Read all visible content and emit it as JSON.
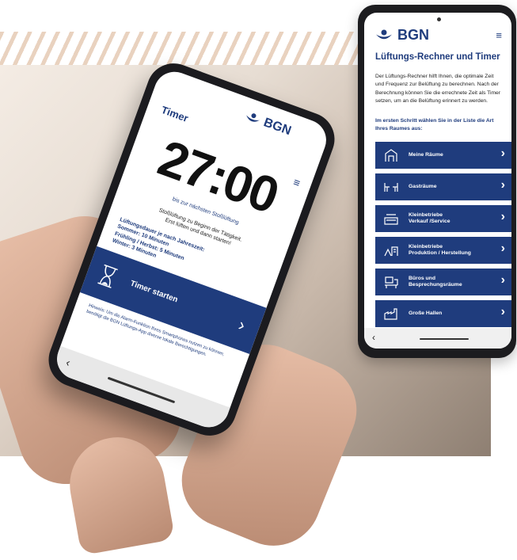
{
  "brand": {
    "logo_text": "BGN",
    "primary_color": "#1f3c7d",
    "accent_stripe_color": "#e9d2bf"
  },
  "phone_left": {
    "screen_title": "Timer",
    "timer_value": "27:00",
    "sub_label": "bis zur nächsten Stoßlüftung",
    "info_lines": [
      "Stoßlüftung zu Beginn der Tätigkeit.",
      "Erst lüften und dann starten!"
    ],
    "season_heading": "Lüftungsdauer je nach Jahreszeit:",
    "seasons": [
      "Sommer: 10 Minuten",
      "Frühling / Herbst: 5 Minuten",
      "Winter: 3 Minuten"
    ],
    "start_button": "Timer starten",
    "hint_text": "Hinweis: Um die Alarm-Funktion Ihres Smartphones nutzen zu können, benötigt die BGN Lüftungs-App diverse lokale Berechtigungen.",
    "menu_icon": "hamburger-icon",
    "back_icon": "chevron-left-icon"
  },
  "phone_right": {
    "app_title": "Lüftungs-Rechner und Timer",
    "description": "Der Lüftungs-Rechner hilft Ihnen, die optimale Zeit und Frequenz zur Belüftung zu berechnen. Nach der Berechnung können Sie die errechnete Zeit als Timer setzen, um an die Belüftung erinnert zu werden.",
    "step_text": "Im ersten Schritt wählen Sie in der Liste die Art Ihres Raumes aus:",
    "menu_icon": "hamburger-icon",
    "back_icon": "chevron-left-icon",
    "rooms": [
      {
        "label": "Meine Räume",
        "icon": "saved-rooms-icon"
      },
      {
        "label": "Gasträume",
        "icon": "dining-tables-icon"
      },
      {
        "label": "Kleinbetriebe\nVerkauf /Service",
        "icon": "counter-icon"
      },
      {
        "label": "Kleinbetriebe\nProduktion / Herstellung",
        "icon": "production-icon"
      },
      {
        "label": "Büros und\nBesprechungsräume",
        "icon": "office-desk-icon"
      },
      {
        "label": "Große Hallen",
        "icon": "factory-hall-icon"
      }
    ]
  }
}
